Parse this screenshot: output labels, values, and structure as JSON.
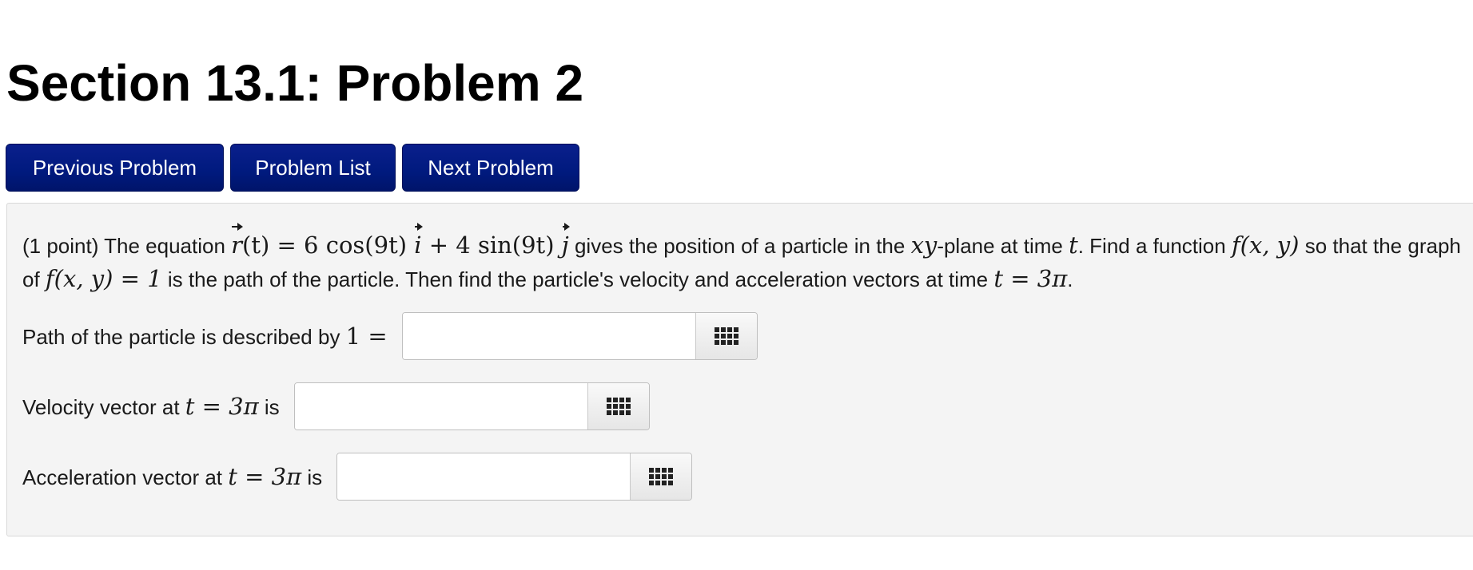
{
  "page": {
    "title": "Section 13.1: Problem 2"
  },
  "nav": {
    "previous_label": "Previous Problem",
    "list_label": "Problem List",
    "next_label": "Next Problem"
  },
  "problem": {
    "points": "(1 point)",
    "text_1": " The equation ",
    "eq_r": "r",
    "eq_t_paren": "(t) = 6 cos(9t) ",
    "eq_i": "i",
    "eq_plus": " + 4 sin(9t) ",
    "eq_j": "j",
    "text_2": " gives the position of a particle in the ",
    "xy": "xy",
    "text_3": "-plane at time ",
    "t": "t",
    "text_4": ". Find a function ",
    "f_xy": "f(x, y)",
    "text_5": " so that the graph of ",
    "f_xy_eq": "f(x, y) = 1",
    "text_6": " is the path of the particle. Then find the particle's velocity and acceleration vectors at time ",
    "t_eq": "t = 3π",
    "text_7": "."
  },
  "answers": [
    {
      "label_text": "Path of the particle is described by ",
      "label_math": "1 =",
      "value": "",
      "placeholder": ""
    },
    {
      "label_text": "Velocity vector at ",
      "label_math": "t = 3π",
      "label_tail": " is",
      "value": "",
      "placeholder": ""
    },
    {
      "label_text": "Acceleration vector at ",
      "label_math": "t = 3π",
      "label_tail": " is",
      "value": "",
      "placeholder": ""
    }
  ],
  "icons": {
    "equation_editor": "grid-icon"
  },
  "colors": {
    "button_bg": "#001a7e",
    "button_text": "#ffffff",
    "panel_bg": "#f4f4f4"
  }
}
